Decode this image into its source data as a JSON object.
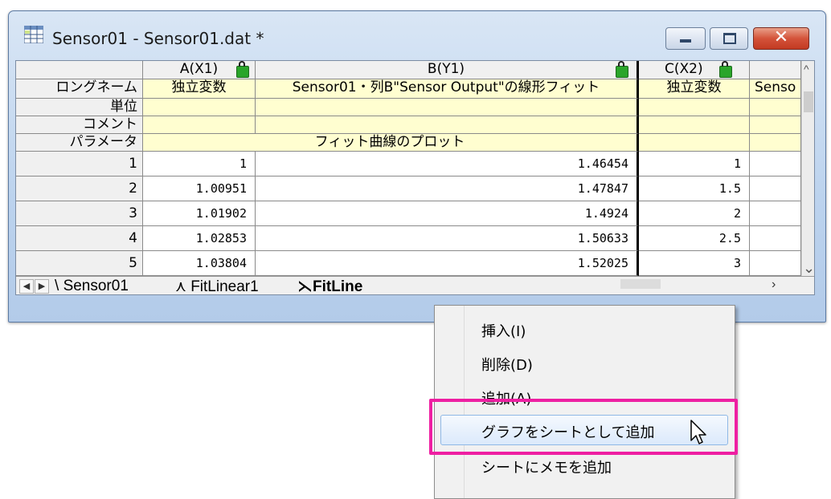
{
  "window": {
    "title": "Sensor01 - Sensor01.dat *",
    "minimize_icon": "minimize-icon",
    "maximize_icon": "maximize-icon",
    "close_icon": "close-icon",
    "close_glyph": "✕"
  },
  "columns": [
    {
      "label": "A(X1)"
    },
    {
      "label": "B(Y1)"
    },
    {
      "label": "C(X2)"
    }
  ],
  "row_labels": {
    "longname": "ロングネーム",
    "units": "単位",
    "comments": "コメント",
    "parameters": "パラメータ"
  },
  "longname": {
    "a": "独立変数",
    "b": "Sensor01・列B\"Sensor Output\"の線形フィット",
    "c": "独立変数",
    "d": "Senso"
  },
  "parameter_text": "フィット曲線のプロット",
  "rows": [
    {
      "n": "1",
      "a": "1",
      "b": "1.46454",
      "c": "1"
    },
    {
      "n": "2",
      "a": "1.00951",
      "b": "1.47847",
      "c": "1.5"
    },
    {
      "n": "3",
      "a": "1.01902",
      "b": "1.4924",
      "c": "2"
    },
    {
      "n": "4",
      "a": "1.02853",
      "b": "1.50633",
      "c": "2.5"
    },
    {
      "n": "5",
      "a": "1.03804",
      "b": "1.52025",
      "c": "3"
    }
  ],
  "sheet_tabs": [
    "Sensor01",
    "FitLinear1",
    "FitLine"
  ],
  "context_menu": {
    "items": [
      "挿入(I)",
      "削除(D)",
      "追加(A)",
      "グラフをシートとして追加",
      "シートにメモを追加"
    ],
    "highlighted": "グラフをシートとして追加"
  },
  "colors": {
    "highlight_border": "#ee1fa2",
    "lock_green": "#2aa52a",
    "param_yellow": "#fffed0"
  }
}
